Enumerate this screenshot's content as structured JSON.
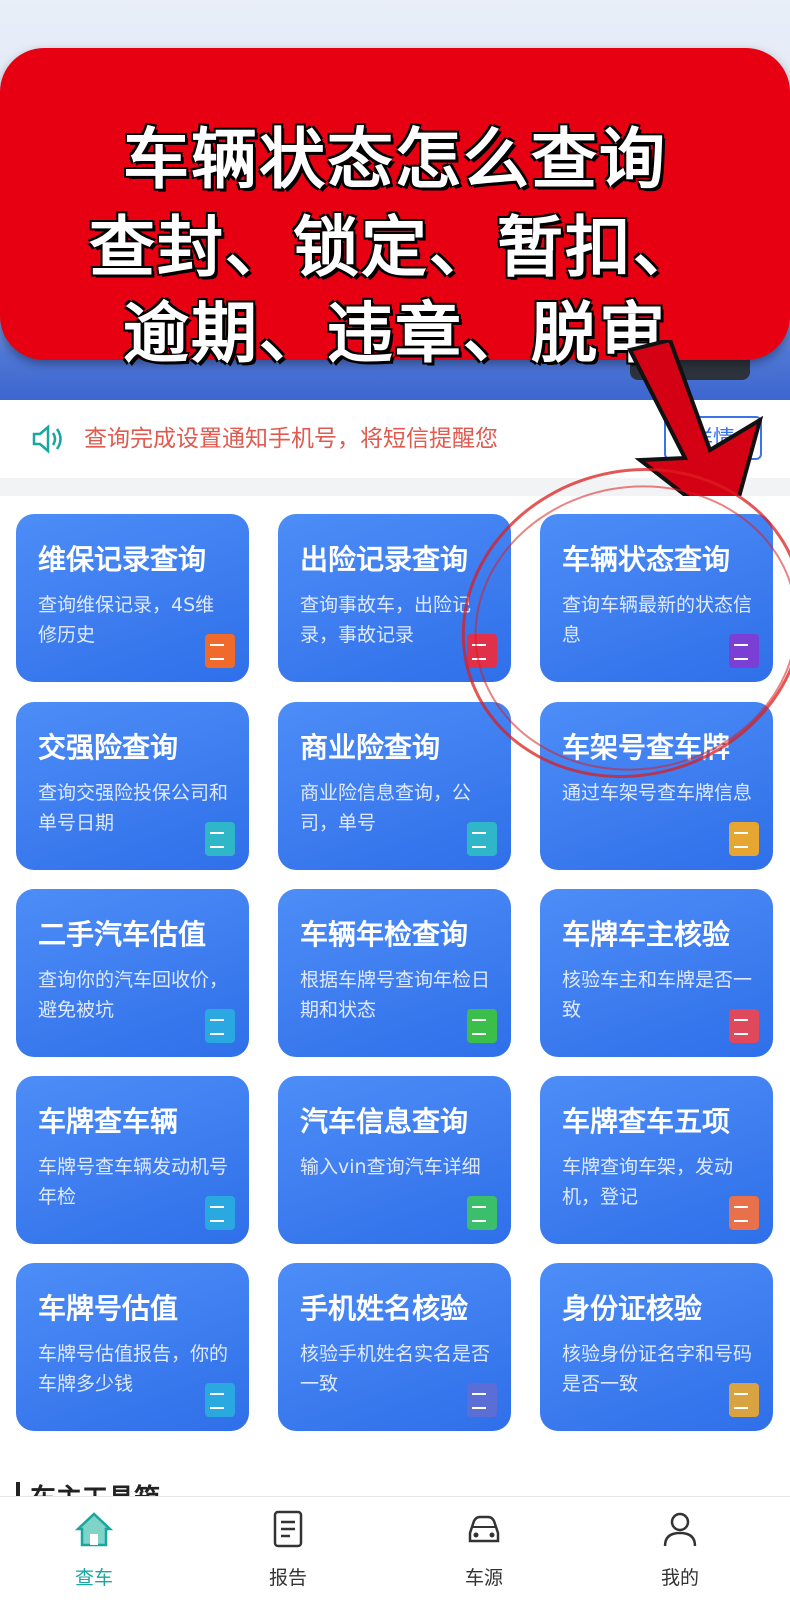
{
  "banner": {
    "line1": "车辆状态怎么查询",
    "line2": "查封、锁定、暂扣、",
    "line3": "逾期、违章、脱审"
  },
  "notice": {
    "text": "查询完成设置通知手机号，将短信提醒您",
    "button": "详情"
  },
  "cards": [
    {
      "title": "维保记录查询",
      "desc": "查询维保记录，4S维修历史",
      "icon_color": "#f06a2b"
    },
    {
      "title": "出险记录查询",
      "desc": "查询事故车，出险记录，事故记录",
      "icon_color": "#e0304a"
    },
    {
      "title": "车辆状态查询",
      "desc": "查询车辆最新的状态信息",
      "icon_color": "#7b3fd6"
    },
    {
      "title": "交强险查询",
      "desc": "查询交强险投保公司和单号日期",
      "icon_color": "#2fb7c9"
    },
    {
      "title": "商业险查询",
      "desc": "商业险信息查询，公司，单号",
      "icon_color": "#2fb7c9"
    },
    {
      "title": "车架号查车牌",
      "desc": "通过车架号查车牌信息",
      "icon_color": "#e7a531"
    },
    {
      "title": "二手汽车估值",
      "desc": "查询你的汽车回收价，避免被坑",
      "icon_color": "#2aa9e0"
    },
    {
      "title": "车辆年检查询",
      "desc": "根据车牌号查询年检日期和状态",
      "icon_color": "#3cbf4a"
    },
    {
      "title": "车牌车主核验",
      "desc": "核验车主和车牌是否一致",
      "icon_color": "#e0485b"
    },
    {
      "title": "车牌查车辆",
      "desc": "车牌号查车辆发动机号年检",
      "icon_color": "#2aa9e0"
    },
    {
      "title": "汽车信息查询",
      "desc": "输入vin查询汽车详细",
      "icon_color": "#3cbf6a"
    },
    {
      "title": "车牌查车五项",
      "desc": "车牌查询车架，发动机，登记",
      "icon_color": "#e8704a"
    },
    {
      "title": "车牌号估值",
      "desc": "车牌号估值报告，你的车牌多少钱",
      "icon_color": "#2aa9e0"
    },
    {
      "title": "手机姓名核验",
      "desc": "核验手机姓名实名是否一致",
      "icon_color": "#5a6ed6"
    },
    {
      "title": "身份证核验",
      "desc": "核验身份证名字和号码是否一致",
      "icon_color": "#d8a340"
    }
  ],
  "section": {
    "title": "车主工具箱"
  },
  "tabbar": [
    {
      "label": "查车",
      "icon": "home-icon"
    },
    {
      "label": "报告",
      "icon": "document-icon"
    },
    {
      "label": "车源",
      "icon": "car-icon"
    },
    {
      "label": "我的",
      "icon": "person-icon"
    }
  ]
}
